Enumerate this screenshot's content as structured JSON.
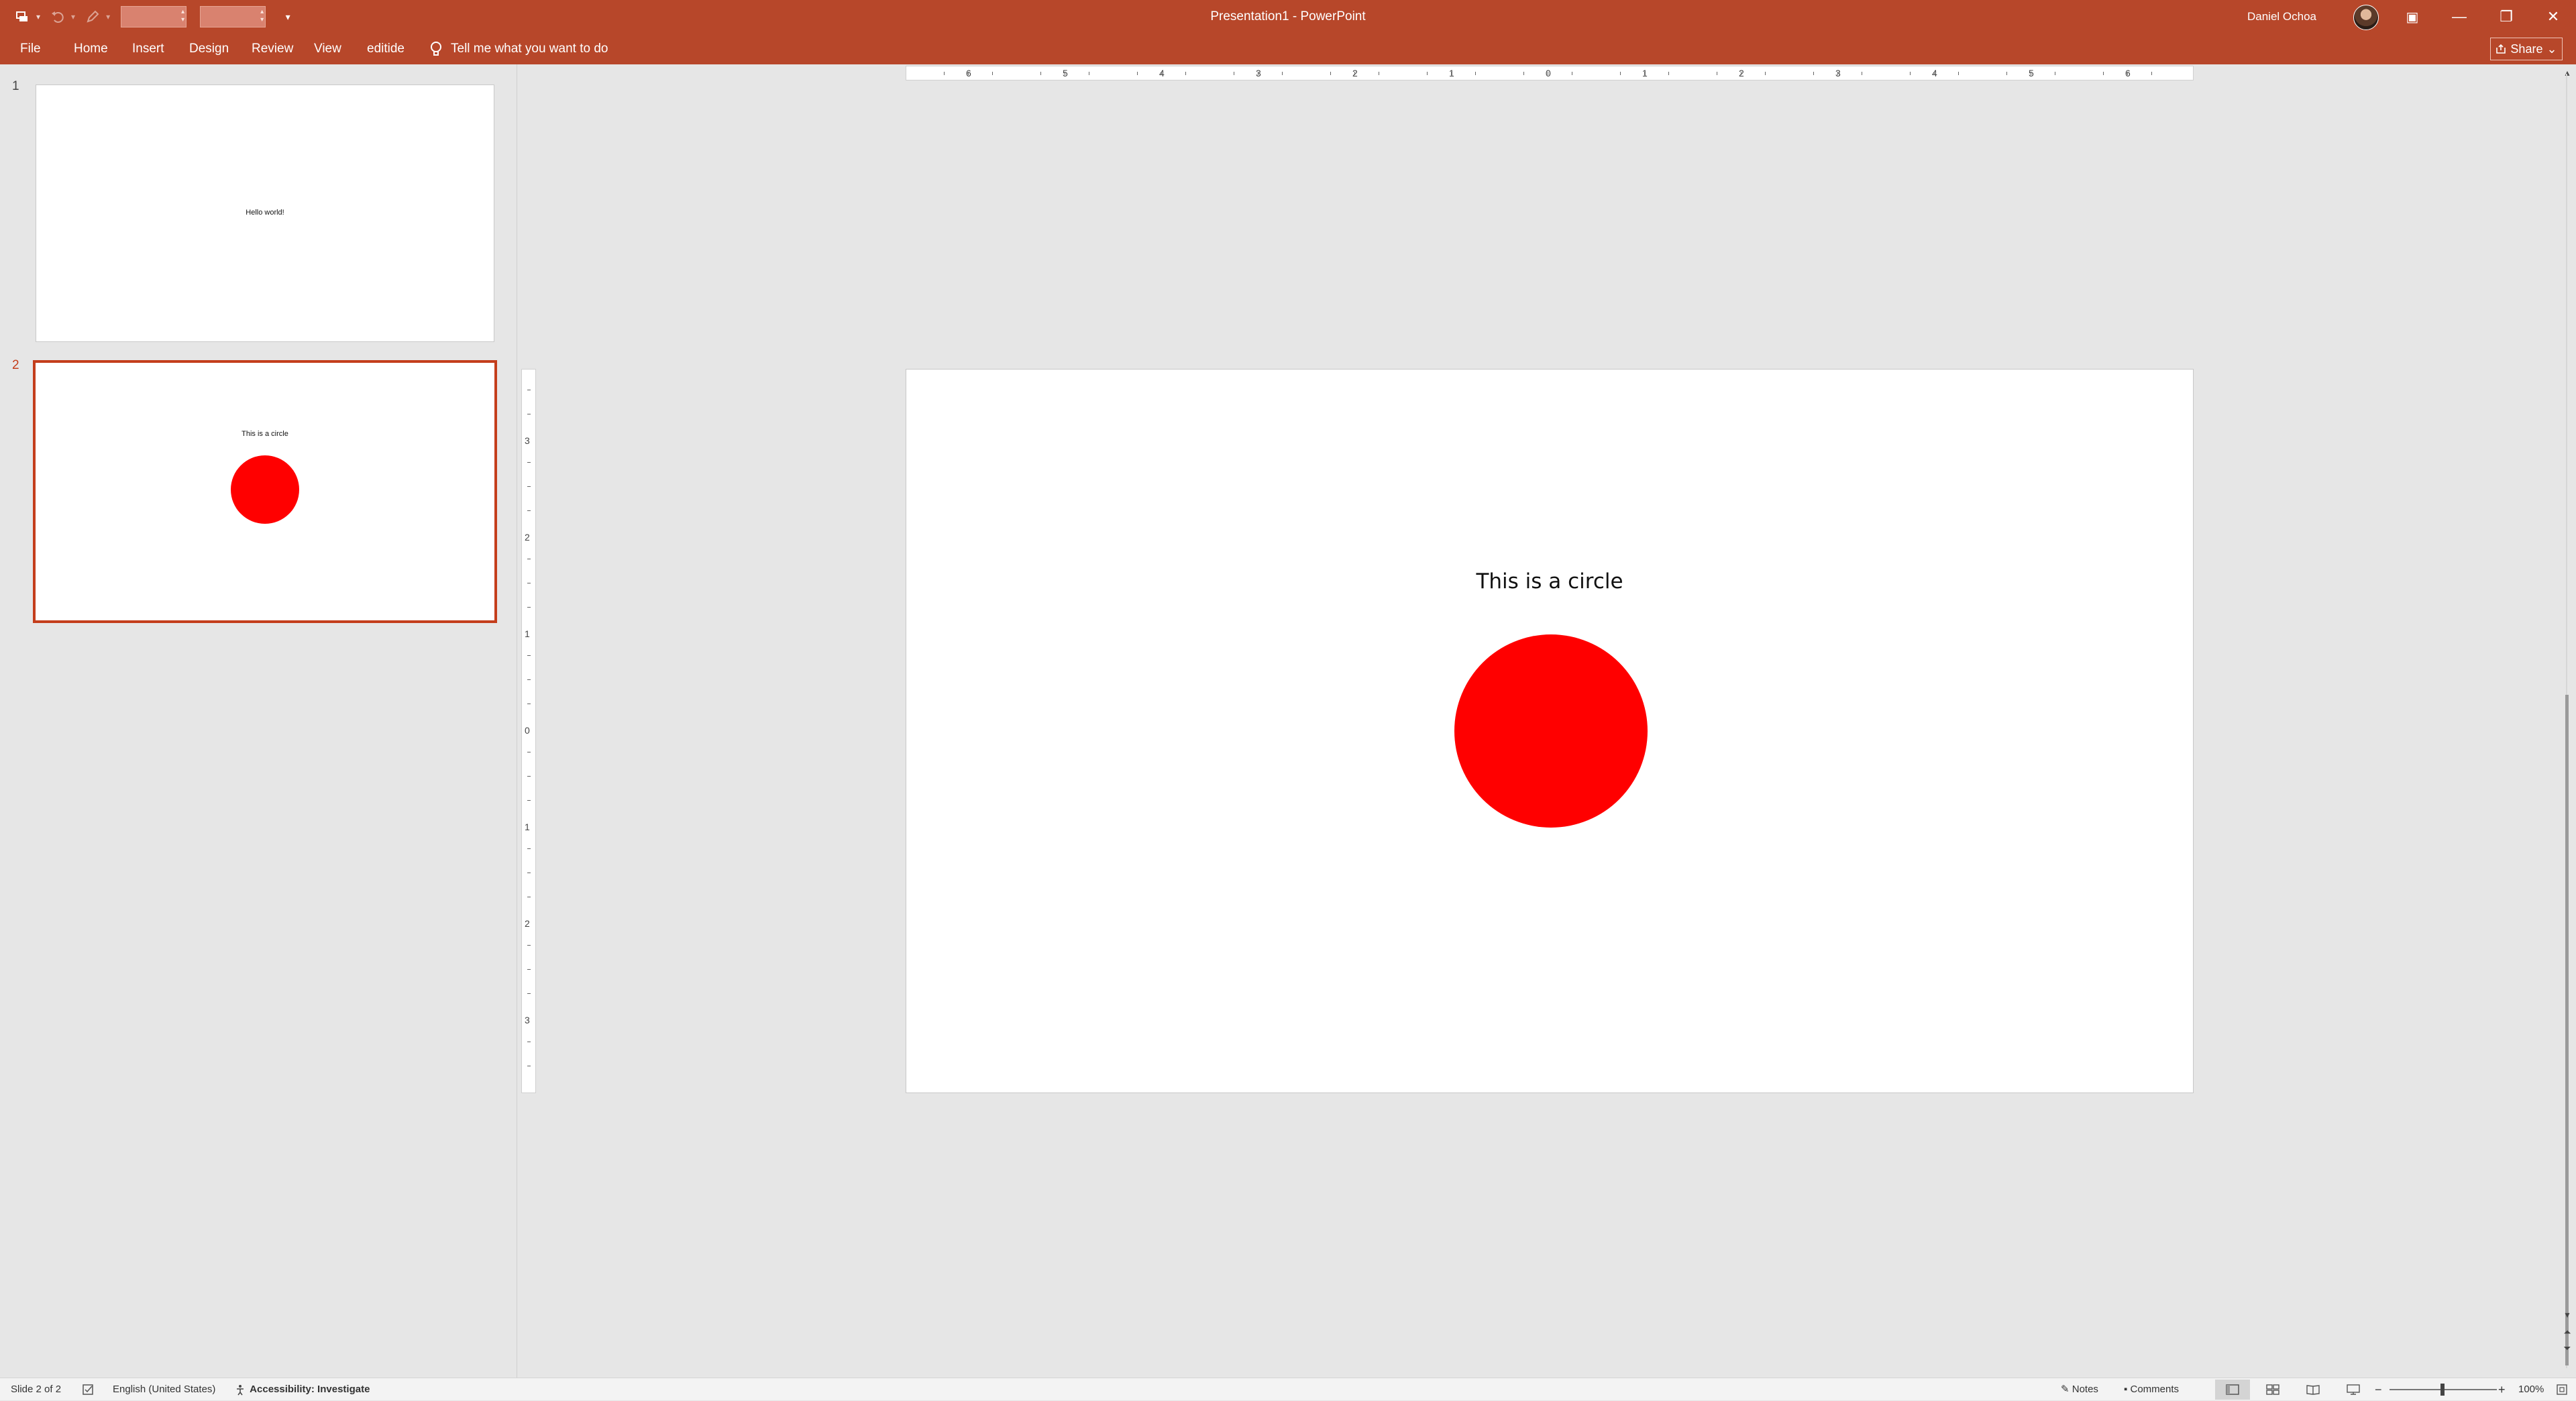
{
  "window": {
    "title": "Presentation1  -  PowerPoint",
    "user_name": "Daniel Ochoa",
    "minimize_glyph": "—",
    "restore_glyph": "❐",
    "close_glyph": "✕",
    "ribbon_display_glyph": "▣"
  },
  "quick_access": {
    "icons": [
      "slide-sorter-icon",
      "undo-icon",
      "pen-icon",
      "customize-icon"
    ],
    "font_box_value": "",
    "size_box_value": "",
    "customize_glyph": "▾"
  },
  "ribbon": {
    "tabs": [
      "File",
      "Home",
      "Insert",
      "Design",
      "Review",
      "View",
      "editide"
    ],
    "tell_me_placeholder": "Tell me what you want to do",
    "share_label": "Share",
    "share_caret": "⌄"
  },
  "thumbnails": [
    {
      "number": "1",
      "text": "Hello world!",
      "has_circle": false,
      "selected": false
    },
    {
      "number": "2",
      "text": "This is a circle",
      "has_circle": true,
      "selected": true
    }
  ],
  "ruler": {
    "horizontal_labels": [
      "6",
      "5",
      "4",
      "3",
      "2",
      "1",
      "0",
      "1",
      "2",
      "3",
      "4",
      "5",
      "6"
    ],
    "vertical_labels": [
      "3",
      "2",
      "1",
      "0",
      "1",
      "2",
      "3"
    ]
  },
  "slide": {
    "text": "This is a circle",
    "circle_color": "#ff0000"
  },
  "status": {
    "slide_indicator": "Slide 2 of 2",
    "language": "English (United States)",
    "accessibility": "Accessibility: Investigate",
    "notes_label": "Notes",
    "comments_label": "Comments",
    "zoom_level": "100%",
    "zoom_minus": "−",
    "zoom_plus": "+"
  },
  "colors": {
    "accent": "#b7472a",
    "selection": "#c43e1c",
    "shape_fill": "#ff0000"
  }
}
